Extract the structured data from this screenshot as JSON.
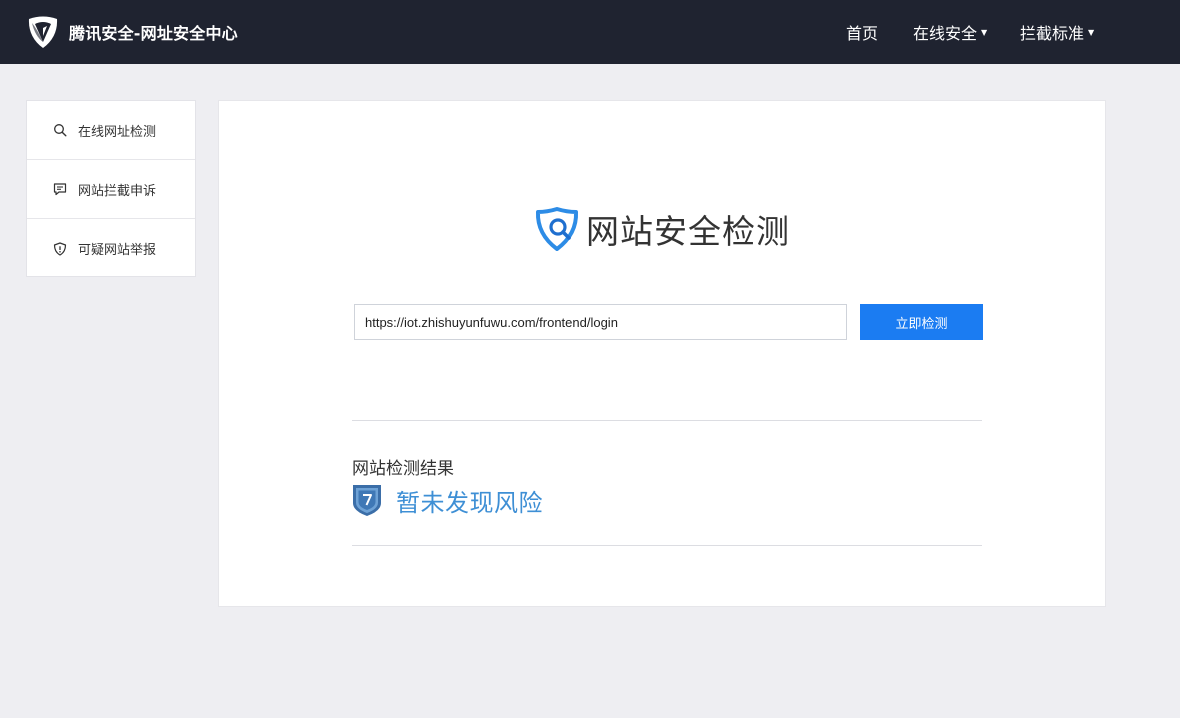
{
  "header": {
    "brand_title": "腾讯安全-网址安全中心",
    "logo_icon": "tencent-security-logo-icon",
    "nav": [
      {
        "label": "首页",
        "has_dropdown": false
      },
      {
        "label": "在线安全",
        "has_dropdown": true
      },
      {
        "label": "拦截标准",
        "has_dropdown": true
      }
    ]
  },
  "sidebar": {
    "items": [
      {
        "label": "在线网址检测",
        "icon": "search-icon"
      },
      {
        "label": "网站拦截申诉",
        "icon": "message-icon"
      },
      {
        "label": "可疑网站举报",
        "icon": "shield-alert-icon"
      }
    ]
  },
  "main": {
    "hero_title": "网站安全检测",
    "hero_icon": "shield-search-icon",
    "url_input": {
      "value": "https://iot.zhishuyunfuwu.com/frontend/login",
      "placeholder": ""
    },
    "check_button_label": "立即检测",
    "result": {
      "title": "网站检测结果",
      "status_text": "暂未发现风险",
      "status_icon": "shield-unknown-icon"
    }
  },
  "colors": {
    "header_bg": "#1f2330",
    "page_bg": "#eeeef2",
    "accent": "#1b7cf2",
    "result_text": "#3e8fd5"
  }
}
